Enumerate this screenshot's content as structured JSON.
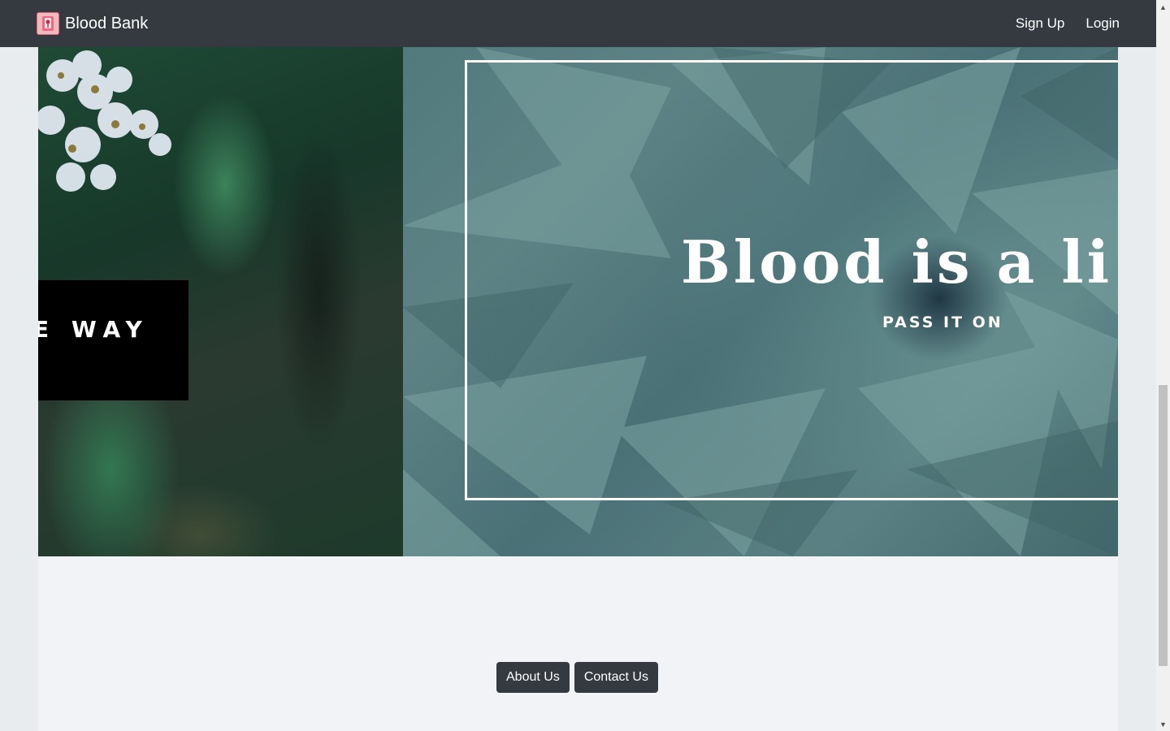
{
  "navbar": {
    "brand": "Blood Bank",
    "links": [
      "Sign Up",
      "Login"
    ]
  },
  "carousel": {
    "left_slide_text": "E WAY",
    "right_slide_title": "Blood is a li",
    "right_slide_subtitle": "PASS IT ON"
  },
  "footer": {
    "buttons": [
      "About Us",
      "Contact Us"
    ]
  },
  "colors": {
    "navbar_bg": "#343a40",
    "button_bg": "#343a40",
    "page_bg": "#f1f3f6"
  }
}
